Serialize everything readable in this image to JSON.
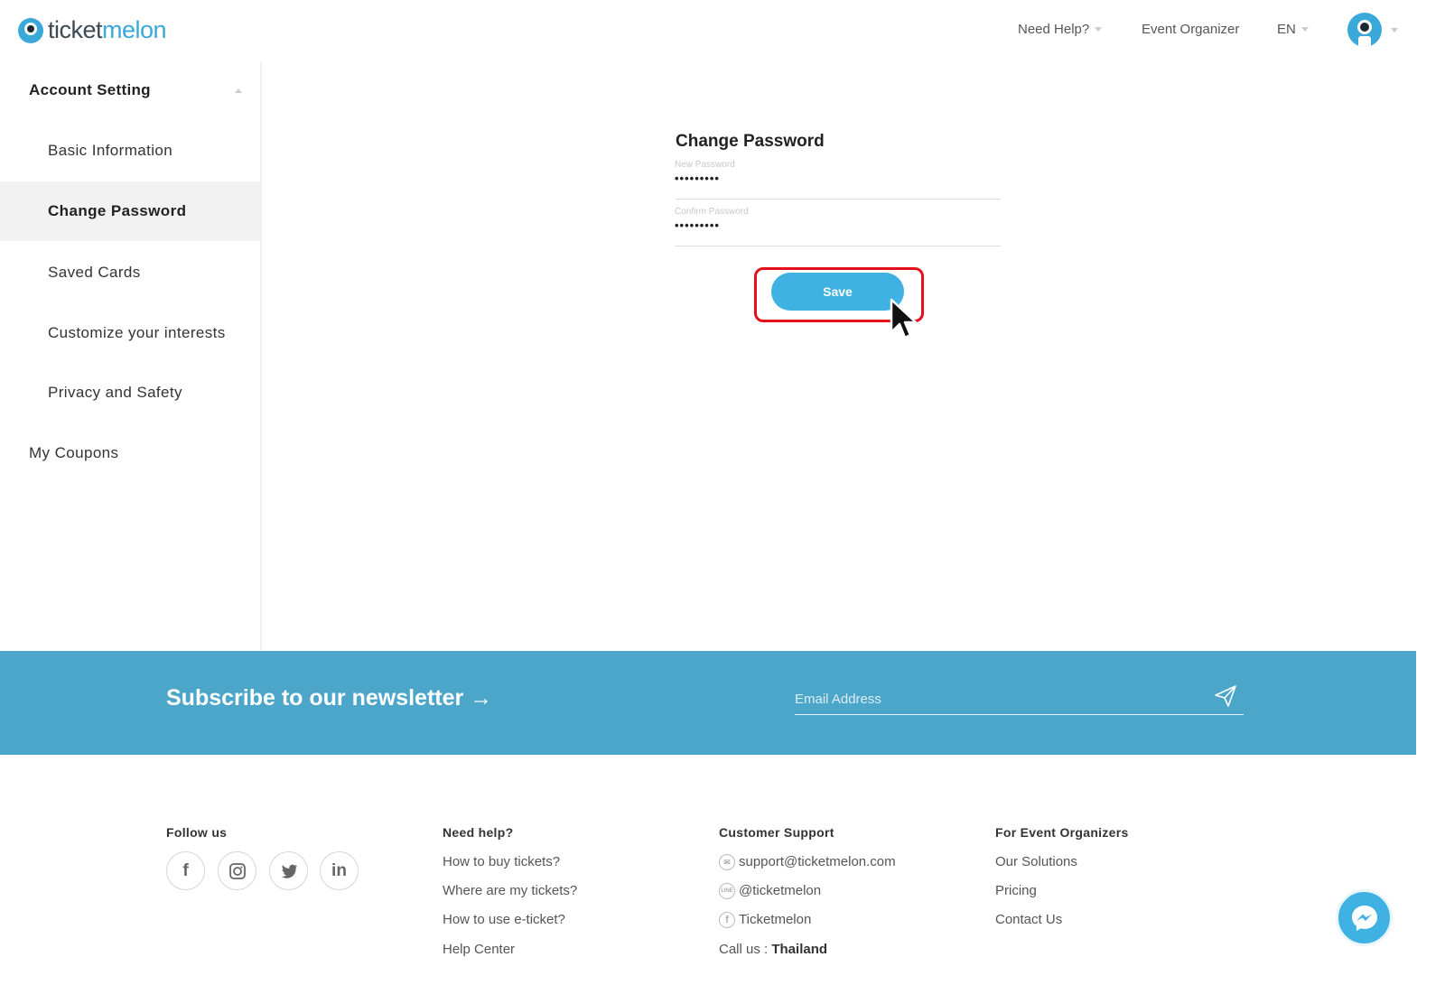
{
  "brand": {
    "part1": "ticket",
    "part2": "melon"
  },
  "nav": {
    "help": "Need Help?",
    "organizer": "Event Organizer",
    "lang": "EN"
  },
  "sidebar": {
    "section": "Account Setting",
    "items": [
      {
        "label": "Basic Information"
      },
      {
        "label": "Change Password"
      },
      {
        "label": "Saved Cards"
      },
      {
        "label": "Customize your interests"
      },
      {
        "label": "Privacy and Safety"
      }
    ],
    "coupons": "My Coupons"
  },
  "form": {
    "title": "Change Password",
    "new_password_label": "New Password",
    "new_password_value": "•••••••••",
    "confirm_password_label": "Confirm Password",
    "confirm_password_value": "•••••••••",
    "save_label": "Save"
  },
  "newsletter": {
    "title": "Subscribe to our newsletter →",
    "placeholder": "Email Address"
  },
  "footer": {
    "follow": {
      "heading": "Follow us",
      "icons": [
        "facebook-icon",
        "instagram-icon",
        "twitter-icon",
        "linkedin-icon"
      ]
    },
    "help": {
      "heading": "Need help?",
      "links": [
        "How to buy tickets?",
        "Where are my tickets?",
        "How to use e-ticket?",
        "Help Center"
      ]
    },
    "support": {
      "heading": "Customer Support",
      "email": "support@ticketmelon.com",
      "line": "@ticketmelon",
      "facebook": "Ticketmelon",
      "call_prefix": "Call us :",
      "call_country": "Thailand"
    },
    "organizers": {
      "heading": "For Event Organizers",
      "links": [
        "Our Solutions",
        "Pricing",
        "Contact Us"
      ]
    }
  },
  "colors": {
    "accent": "#3fb2e3",
    "newsletter_bg": "#4ba6c9",
    "highlight": "#e3101c"
  }
}
